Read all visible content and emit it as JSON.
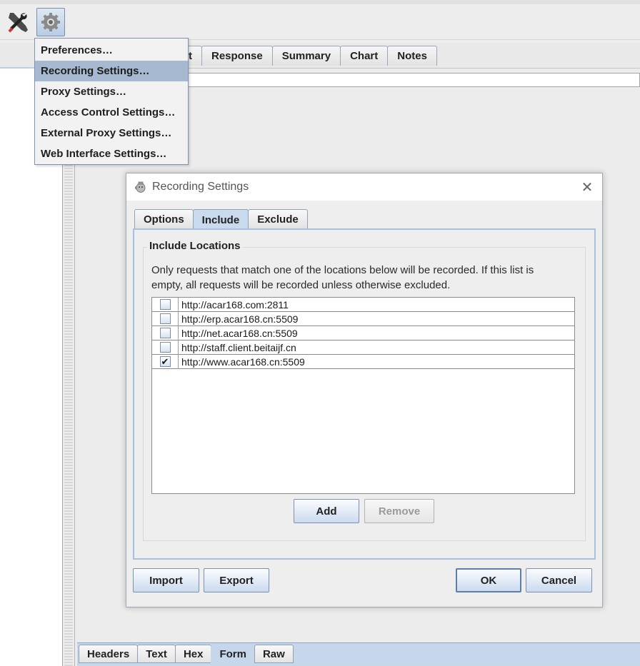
{
  "toolbar": {
    "tools_icon": "tools-icon",
    "settings_icon": "gear-icon"
  },
  "menu": {
    "items": [
      {
        "label": "Preferences…"
      },
      {
        "label": "Recording Settings…"
      },
      {
        "label": "Proxy Settings…"
      },
      {
        "label": "Access Control Settings…"
      },
      {
        "label": "External Proxy Settings…"
      },
      {
        "label": "Web Interface Settings…"
      }
    ]
  },
  "main_tabs": [
    {
      "label": "t"
    },
    {
      "label": "Response"
    },
    {
      "label": "Summary"
    },
    {
      "label": "Chart"
    },
    {
      "label": "Notes"
    }
  ],
  "bottom_tabs": [
    {
      "label": "Headers"
    },
    {
      "label": "Text"
    },
    {
      "label": "Hex"
    },
    {
      "label": "Form"
    },
    {
      "label": "Raw"
    }
  ],
  "dialog": {
    "title": "Recording Settings",
    "tabs": [
      {
        "label": "Options"
      },
      {
        "label": "Include"
      },
      {
        "label": "Exclude"
      }
    ],
    "group_title": "Include Locations",
    "description": "Only requests that match one of the locations below will be recorded. If this list is empty, all requests will be recorded unless otherwise excluded.",
    "locations": [
      {
        "url": "http://acar168.com:2811",
        "checked": false
      },
      {
        "url": "http://erp.acar168.cn:5509",
        "checked": false
      },
      {
        "url": "http://net.acar168.cn:5509",
        "checked": false
      },
      {
        "url": "http://staff.client.beitaijf.cn",
        "checked": false
      },
      {
        "url": "http://www.acar168.cn:5509",
        "checked": true
      }
    ],
    "add_label": "Add",
    "remove_label": "Remove",
    "import_label": "Import",
    "export_label": "Export",
    "ok_label": "OK",
    "cancel_label": "Cancel",
    "check_mark": "✔"
  }
}
